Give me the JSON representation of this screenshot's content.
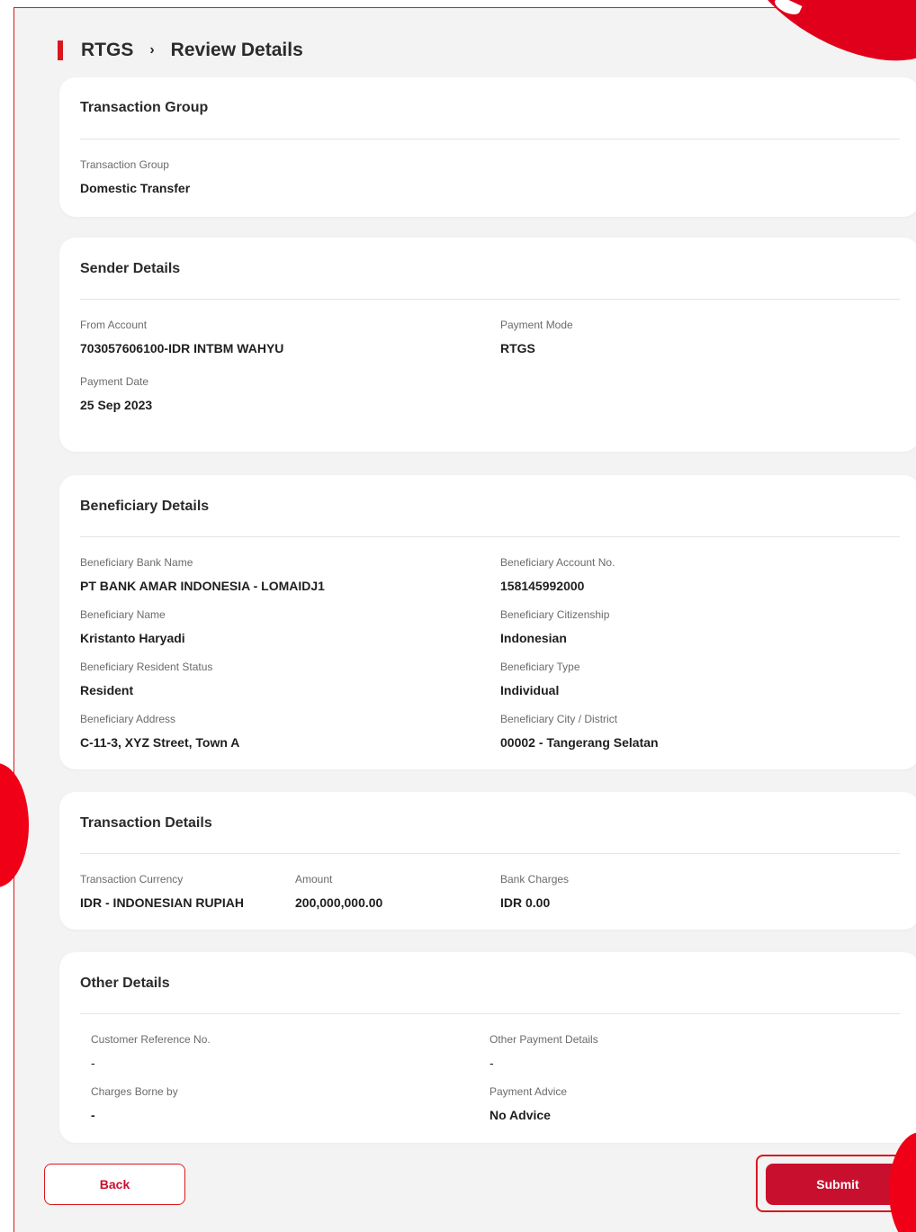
{
  "breadcrumb": {
    "root": "RTGS",
    "separator": "›",
    "current": "Review Details"
  },
  "transaction_group": {
    "title": "Transaction Group",
    "label": "Transaction Group",
    "value": "Domestic Transfer"
  },
  "sender": {
    "title": "Sender Details",
    "from_account_label": "From Account",
    "from_account_value": "703057606100-IDR INTBM WAHYU",
    "payment_mode_label": "Payment Mode",
    "payment_mode_value": "RTGS",
    "payment_date_label": "Payment Date",
    "payment_date_value": "25 Sep 2023"
  },
  "beneficiary": {
    "title": "Beneficiary Details",
    "bank_name_label": "Beneficiary Bank Name",
    "bank_name_value": "PT BANK AMAR INDONESIA - LOMAIDJ1",
    "account_no_label": "Beneficiary Account No.",
    "account_no_value": "158145992000",
    "name_label": "Beneficiary Name",
    "name_value": "Kristanto Haryadi",
    "citizenship_label": "Beneficiary Citizenship",
    "citizenship_value": "Indonesian",
    "resident_status_label": "Beneficiary Resident Status",
    "resident_status_value": "Resident",
    "type_label": "Beneficiary Type",
    "type_value": "Individual",
    "address_label": "Beneficiary Address",
    "address_value": "C-11-3, XYZ Street, Town A",
    "city_label": "Beneficiary City / District",
    "city_value": "00002 - Tangerang Selatan"
  },
  "transaction": {
    "title": "Transaction Details",
    "currency_label": "Transaction Currency",
    "currency_value": "IDR - INDONESIAN RUPIAH",
    "amount_label": "Amount",
    "amount_value": "200,000,000.00",
    "charges_label": "Bank Charges",
    "charges_value": "IDR 0.00"
  },
  "other": {
    "title": "Other Details",
    "customer_ref_label": "Customer Reference No.",
    "customer_ref_value": "-",
    "other_payment_label": "Other Payment Details",
    "other_payment_value": "-",
    "charges_borne_label": "Charges Borne by",
    "charges_borne_value": "-",
    "payment_advice_label": "Payment Advice",
    "payment_advice_value": "No Advice"
  },
  "actions": {
    "back_label": "Back",
    "submit_label": "Submit"
  },
  "colors": {
    "accent": "#d9171f",
    "button_primary": "#c8102e",
    "background": "#f3f3f3",
    "card": "#ffffff"
  }
}
